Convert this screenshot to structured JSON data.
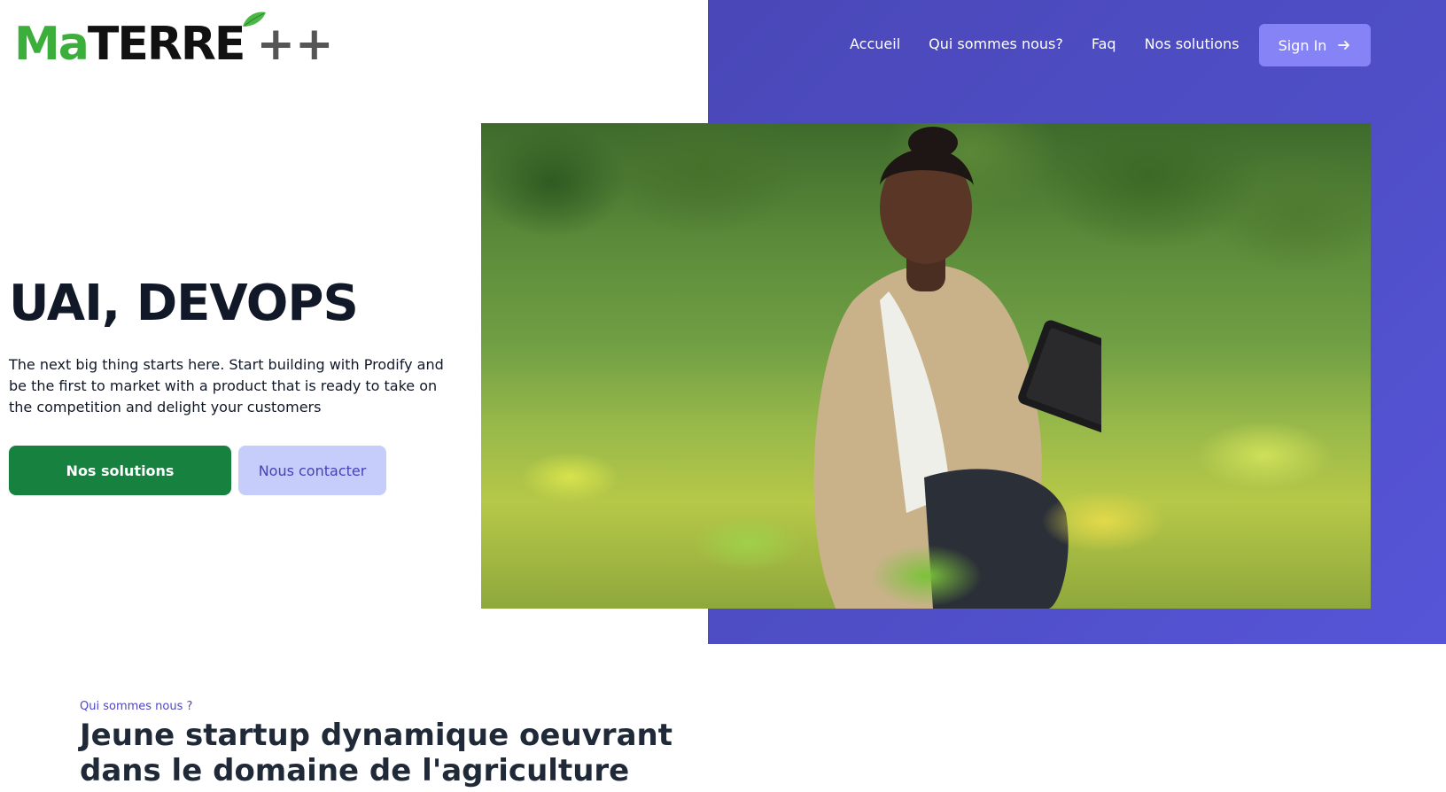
{
  "logo": {
    "part_ma": "Ma",
    "part_terre": "TERRE",
    "part_plus": "++"
  },
  "nav": {
    "items": [
      {
        "label": "Accueil"
      },
      {
        "label": "Qui sommes nous?"
      },
      {
        "label": "Faq"
      },
      {
        "label": "Nos solutions"
      }
    ],
    "signin_label": "Sign In",
    "signin_icon": "arrow-right-icon"
  },
  "hero": {
    "title": "UAI, DEVOPS",
    "description": "The next big thing starts here. Start building with Prodify and be the first to market with a product that is ready to take on the competition and delight your customers",
    "primary_button": "Nos solutions",
    "secondary_button": "Nous contacter"
  },
  "about": {
    "eyebrow": "Qui sommes nous ?",
    "title": "Jeune startup dynamique oeuvrant dans le domaine de l'agriculture"
  },
  "colors": {
    "accent_purple": "#4f4ec6",
    "signin_bg": "#8583f5",
    "primary_green": "#17813f",
    "secondary_bg": "#c6cdfb",
    "logo_green": "#3cae3c"
  }
}
